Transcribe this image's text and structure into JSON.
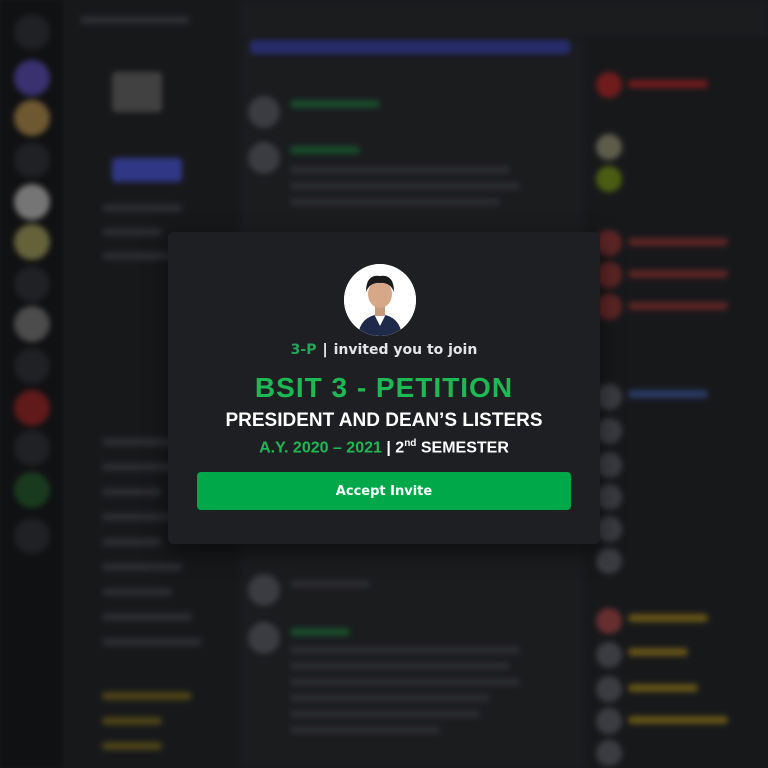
{
  "invite": {
    "inviter": "3-P",
    "separator": "|",
    "message": "invited you to join",
    "title": "BSIT 3 - PETITION",
    "subtitle": "PRESIDENT AND DEAN’S LISTERS",
    "academic_year": "A.Y. 2020 – 2021",
    "year_separator": "|",
    "semester_number": "2",
    "semester_suffix": "nd",
    "semester_label": "SEMESTER",
    "accept_label": "Accept Invite"
  },
  "colors": {
    "accent_green": "#1db954",
    "button_green": "#00a849",
    "modal_bg": "#1e1f22"
  }
}
